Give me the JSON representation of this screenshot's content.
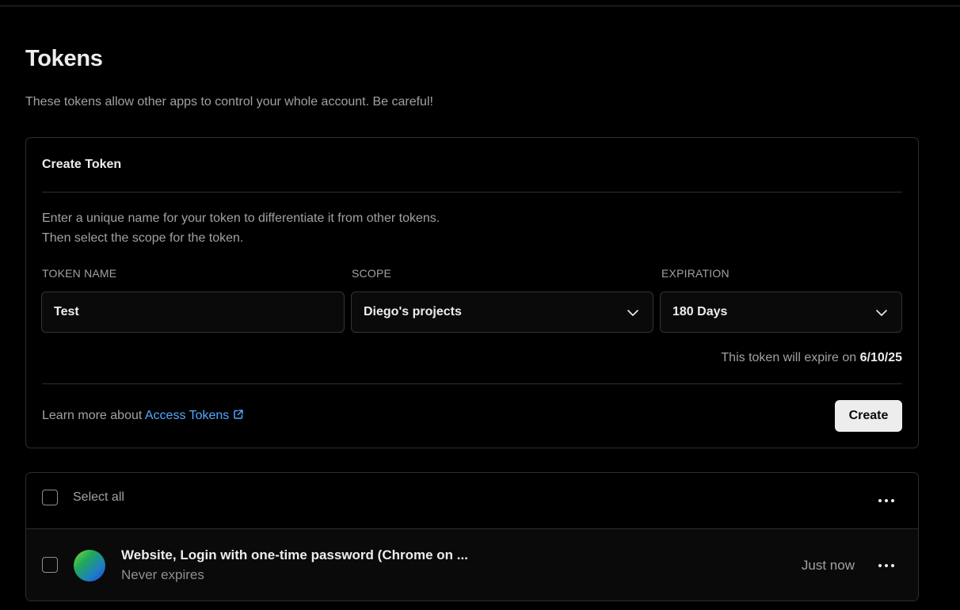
{
  "page": {
    "title": "Tokens",
    "description": "These tokens allow other apps to control your whole account. Be careful!"
  },
  "create_token": {
    "title": "Create Token",
    "instructions_line1": "Enter a unique name for your token to differentiate it from other tokens.",
    "instructions_line2": "Then select the scope for the token.",
    "name_label": "TOKEN NAME",
    "name_value": "Test",
    "scope_label": "SCOPE",
    "scope_value": "Diego's projects",
    "expiration_label": "EXPIRATION",
    "expiration_value": "180 Days",
    "expire_note_prefix": "This token will expire on",
    "expire_date": "6/10/25",
    "learn_more_prefix": "Learn more about",
    "learn_more_link": "Access Tokens",
    "create_button": "Create"
  },
  "token_list": {
    "select_all": "Select all",
    "tokens": [
      {
        "name": "Website, Login with one-time password (Chrome on ...",
        "expiry": "Never expires",
        "created": "Just now"
      }
    ]
  },
  "colors": {
    "background": "#000000",
    "border": "#2e2e2e",
    "link": "#52a8ff",
    "button_bg": "#ededed"
  },
  "icons": {
    "chevron": "chevron-down-icon",
    "external": "external-link-icon",
    "more": "more-horizontal-icon"
  }
}
